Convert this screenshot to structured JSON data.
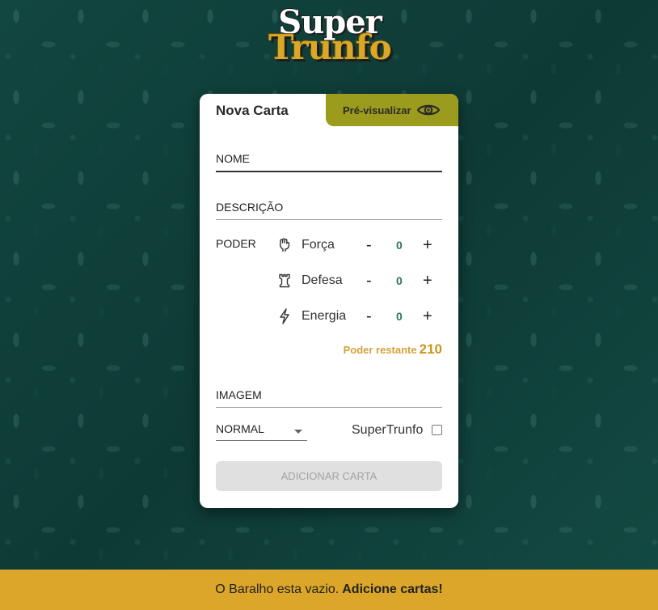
{
  "logo": {
    "line1": "Super",
    "line2": "Trunfo"
  },
  "tabs": {
    "new_card": "Nova Carta",
    "preview": "Pré-visualizar"
  },
  "form": {
    "name_label": "NOME",
    "description_label": "DESCRIÇÃO",
    "power_label": "PODER",
    "stats": [
      {
        "label": "Força",
        "icon": "fist-icon",
        "value": "0",
        "minus": "-",
        "plus": "+"
      },
      {
        "label": "Defesa",
        "icon": "tower-icon",
        "value": "0",
        "minus": "-",
        "plus": "+"
      },
      {
        "label": "Energia",
        "icon": "lightning-icon",
        "value": "0",
        "minus": "-",
        "plus": "+"
      }
    ],
    "remaining_label": "Poder restante",
    "remaining_value": "210",
    "image_label": "IMAGEM",
    "rarity_selected": "NORMAL",
    "supertrunfo_label": "SuperTrunfo",
    "supertrunfo_checked": false,
    "add_button": "ADICIONAR CARTA"
  },
  "footer": {
    "message": "O Baralho esta vazio.",
    "link": "Adicione cartas!"
  },
  "colors": {
    "primary_green": "#0f3b36",
    "olive": "#9b9b1d",
    "gold": "#dba629"
  }
}
